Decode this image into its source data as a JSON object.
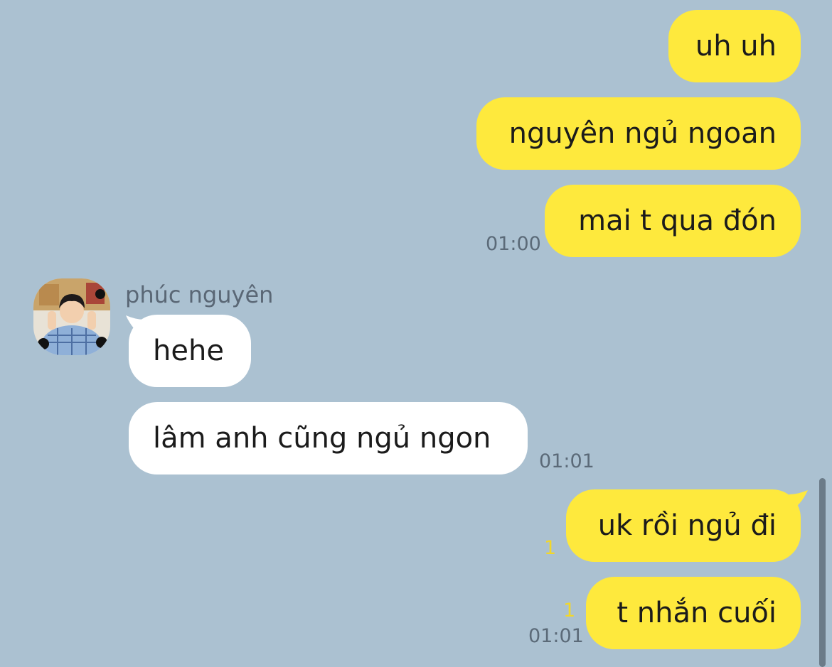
{
  "colors": {
    "background": "#abc1d1",
    "my_bubble": "#fee93d",
    "their_bubble": "#ffffff",
    "unread_count": "#f2d72a"
  },
  "sender": {
    "name": "phúc nguyên",
    "avatar_icon": "profile-photo"
  },
  "messages": [
    {
      "from": "me",
      "text": "uh uh"
    },
    {
      "from": "me",
      "text": "nguyên ngủ ngoan"
    },
    {
      "from": "me",
      "text": "mai t qua đón",
      "time": "01:00"
    },
    {
      "from": "them",
      "text": "hehe"
    },
    {
      "from": "them",
      "text": "lâm anh cũng ngủ ngon",
      "time": "01:01"
    },
    {
      "from": "me",
      "text": "uk rồi ngủ đi",
      "unread": "1"
    },
    {
      "from": "me",
      "text": "t nhắn cuối",
      "unread": "1",
      "time": "01:01"
    }
  ]
}
